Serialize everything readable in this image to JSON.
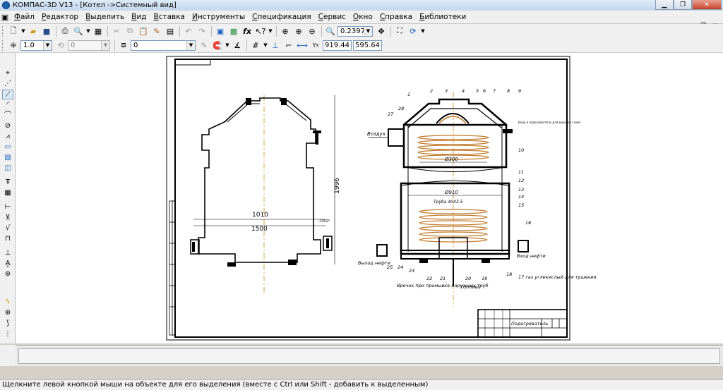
{
  "window": {
    "title": "КОМПАС-3D V13 - [Котел ->Системный вид]"
  },
  "menu": [
    {
      "label": "Файл",
      "ul": "Ф",
      "rest": "айл"
    },
    {
      "label": "Редактор",
      "ul": "Р",
      "rest": "едактор"
    },
    {
      "label": "Выделить",
      "ul": "В",
      "rest": "ыделить"
    },
    {
      "label": "Вид",
      "ul": "В",
      "rest": "ид"
    },
    {
      "label": "Вставка",
      "ul": "В",
      "rest": "ставка"
    },
    {
      "label": "Инструменты",
      "ul": "И",
      "rest": "нструменты"
    },
    {
      "label": "Спецификация",
      "ul": "С",
      "rest": "пецификация"
    },
    {
      "label": "Сервис",
      "ul": "С",
      "rest": "ервис"
    },
    {
      "label": "Окно",
      "ul": "О",
      "rest": "кно"
    },
    {
      "label": "Справка",
      "ul": "С",
      "rest": "правка"
    },
    {
      "label": "Библиотеки",
      "ul": "Б",
      "rest": "иблиотеки"
    }
  ],
  "toolbar": {
    "zoom_value": "0.2397",
    "style_scale": "1.0",
    "style_layer": "0",
    "layer_value": "0",
    "coord_x": "919.44",
    "coord_y": "595.64"
  },
  "drawing": {
    "left_view": {
      "dim_1010": "1010",
      "dim_1500": "1500",
      "dim_1996": "1996",
      "dim_small": "2302*"
    },
    "right_view": {
      "label_air": "Воздух",
      "label_oil_out": "Выход нефти",
      "label_oil_in": "Вход нефти",
      "label_fuel": "Топливо",
      "label_gas": "17 газ углекислый для тушения",
      "label_pipe": "Труба 40X3.5",
      "label_note": "Вречок при промывке наружних труб",
      "label_top_note": "Вход в подогреватель для выпуска газов",
      "dim_d300": "Ø300",
      "dim_d910": "Ø910",
      "callouts": [
        "1",
        "2",
        "3",
        "4",
        "5",
        "6",
        "7",
        "8",
        "9",
        "10",
        "11",
        "12",
        "13",
        "14",
        "15",
        "16",
        "18",
        "19",
        "20",
        "21",
        "22",
        "23",
        "24",
        "25",
        "27",
        "28"
      ]
    },
    "title_block": {
      "name": "Подогреватель"
    }
  },
  "status": {
    "message": "Щелкните левой кнопкой мыши на объекте для его выделения (вместе с Ctrl или Shift - добавить к выделенным)"
  }
}
